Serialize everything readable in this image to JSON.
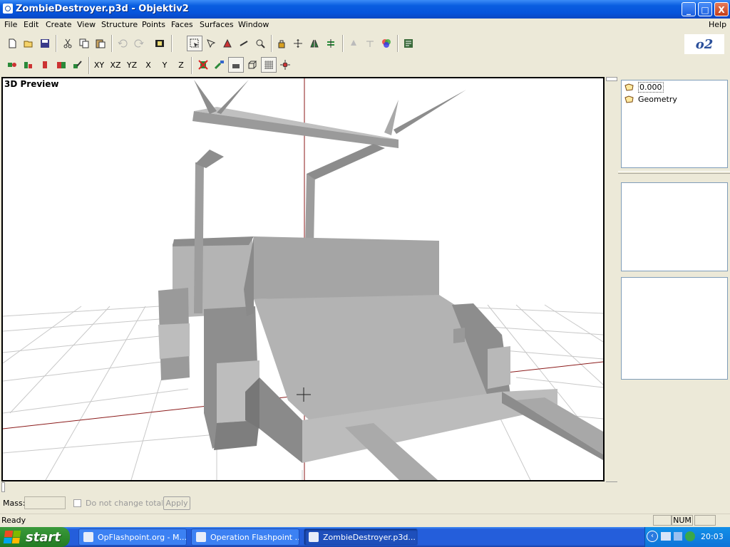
{
  "window": {
    "title": "ZombieDestroyer.p3d - Objektiv2",
    "minimize": "_",
    "maximize": "□",
    "close": "X"
  },
  "menu": {
    "items": [
      "File",
      "Edit",
      "Create",
      "View",
      "Structure",
      "Points",
      "Faces",
      "Surfaces",
      "Window"
    ],
    "help": "Help"
  },
  "toolbar": {
    "axes": [
      "XY",
      "XZ",
      "YZ",
      "X",
      "Y",
      "Z"
    ],
    "icons_row1": [
      "new-file-icon",
      "open-folder-icon",
      "save-icon",
      "cut-icon",
      "copy-icon",
      "paste-icon",
      "undo-icon",
      "redo-icon",
      "preview-icon",
      "select-icon",
      "select-faces-icon",
      "paint-select-icon",
      "lasso-icon",
      "zoom-icon",
      "lock-icon",
      "move-icon",
      "mirror-icon",
      "flip-icon",
      "pin-icon",
      "anchor-icon",
      "color-wheel-icon",
      "script-icon"
    ],
    "icons_row2": [
      "lod-prev-icon",
      "lod-next-icon",
      "lod-red-icon",
      "lod-cubes-icon",
      "lod-edit-icon",
      "hide-icon",
      "cursor-icon",
      "texture-icon",
      "cube-icon",
      "grid-icon",
      "gear-icon"
    ]
  },
  "logo": "o2",
  "viewport": {
    "label": "3D Preview"
  },
  "lod_list": {
    "items": [
      {
        "label": "0.000",
        "icon": "lod-icon",
        "selected": true
      },
      {
        "label": "Geometry",
        "icon": "lod-icon",
        "selected": false
      }
    ]
  },
  "mass": {
    "label": "Mass:",
    "value": "",
    "checkbox_label": "Do not change total ma",
    "apply_label": "Apply"
  },
  "status": {
    "text": "Ready",
    "num": "NUM"
  },
  "taskbar": {
    "start": "start",
    "tasks": [
      {
        "label": "OpFlashpoint.org - M...",
        "active": false
      },
      {
        "label": "Operation Flashpoint ...",
        "active": false
      },
      {
        "label": "ZombieDestroyer.p3d...",
        "active": true
      }
    ],
    "clock": "20:03"
  },
  "colors": {
    "titlebar": "#0a5ee0",
    "taskbar": "#245edb",
    "start_green": "#2e8c2e",
    "model_grey": "#a8a8a8",
    "axis_red": "#8b1a1a"
  }
}
